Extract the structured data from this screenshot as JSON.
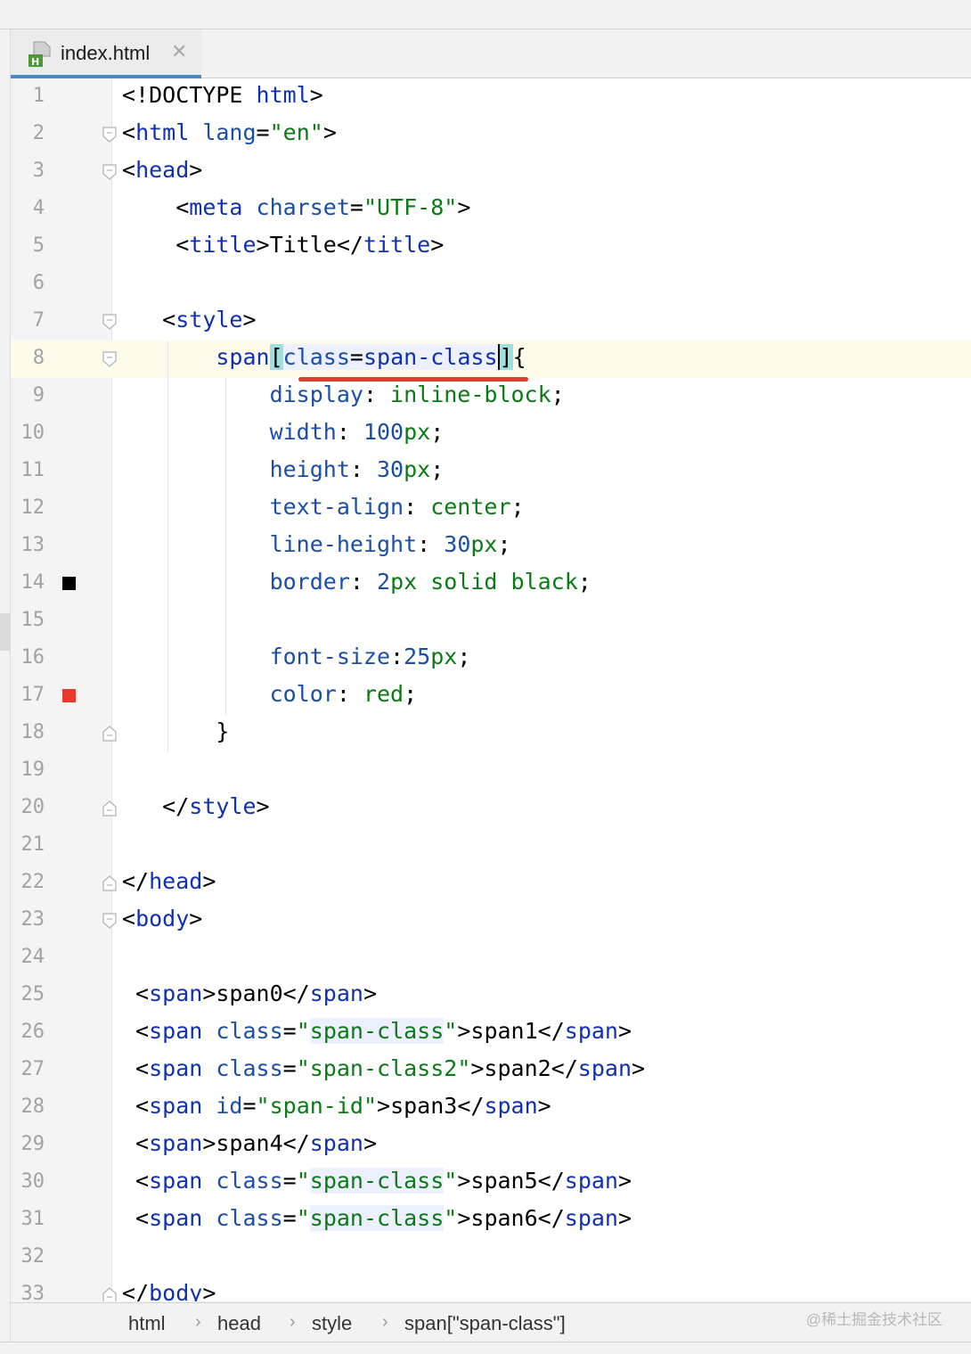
{
  "tab": {
    "filename": "index.html",
    "close": "✕",
    "icon": "html-file-icon"
  },
  "editor": {
    "lines": [
      {
        "n": "1",
        "segs": [
          [
            "p",
            "<!DOCTYPE "
          ],
          [
            "tg",
            "html"
          ],
          [
            "p",
            ">"
          ]
        ]
      },
      {
        "n": "2",
        "fold": "open",
        "segs": [
          [
            "p",
            "<"
          ],
          [
            "tg",
            "html "
          ],
          [
            "at",
            "lang"
          ],
          [
            "p",
            "="
          ],
          [
            "st",
            "\"en\""
          ],
          [
            "p",
            ">"
          ]
        ]
      },
      {
        "n": "3",
        "fold": "open",
        "segs": [
          [
            "p",
            "<"
          ],
          [
            "tg",
            "head"
          ],
          [
            "p",
            ">"
          ]
        ]
      },
      {
        "n": "4",
        "segs": [
          [
            "p",
            "    <"
          ],
          [
            "tg",
            "meta "
          ],
          [
            "at",
            "charset"
          ],
          [
            "p",
            "="
          ],
          [
            "st",
            "\"UTF-8\""
          ],
          [
            "p",
            ">"
          ]
        ]
      },
      {
        "n": "5",
        "segs": [
          [
            "p",
            "    <"
          ],
          [
            "tg",
            "title"
          ],
          [
            "p",
            ">Title</"
          ],
          [
            "tg",
            "title"
          ],
          [
            "p",
            ">"
          ]
        ]
      },
      {
        "n": "6",
        "segs": []
      },
      {
        "n": "7",
        "fold": "open",
        "segs": [
          [
            "p",
            "   <"
          ],
          [
            "tg",
            "style"
          ],
          [
            "p",
            ">"
          ]
        ]
      },
      {
        "n": "8",
        "fold": "open",
        "current": true,
        "segs": [
          [
            "p",
            "       "
          ],
          [
            "tg",
            "span"
          ],
          [
            "br",
            "["
          ],
          [
            "sel-at",
            "class"
          ],
          [
            "sel-p",
            "="
          ],
          [
            "sel-tg",
            "span-clas"
          ],
          [
            "sel-tg-caret",
            "s"
          ],
          [
            "br",
            "]"
          ],
          [
            "p",
            "{"
          ]
        ]
      },
      {
        "n": "9",
        "segs": [
          [
            "p",
            "           "
          ],
          [
            "pr",
            "display"
          ],
          [
            "p",
            ": "
          ],
          [
            "vl",
            "inline-block"
          ],
          [
            "p",
            ";"
          ]
        ]
      },
      {
        "n": "10",
        "segs": [
          [
            "p",
            "           "
          ],
          [
            "pr",
            "width"
          ],
          [
            "p",
            ": "
          ],
          [
            "nm",
            "100"
          ],
          [
            "un",
            "px"
          ],
          [
            "p",
            ";"
          ]
        ]
      },
      {
        "n": "11",
        "segs": [
          [
            "p",
            "           "
          ],
          [
            "pr",
            "height"
          ],
          [
            "p",
            ": "
          ],
          [
            "nm",
            "30"
          ],
          [
            "un",
            "px"
          ],
          [
            "p",
            ";"
          ]
        ]
      },
      {
        "n": "12",
        "segs": [
          [
            "p",
            "           "
          ],
          [
            "pr",
            "text-align"
          ],
          [
            "p",
            ": "
          ],
          [
            "vl",
            "center"
          ],
          [
            "p",
            ";"
          ]
        ]
      },
      {
        "n": "13",
        "segs": [
          [
            "p",
            "           "
          ],
          [
            "pr",
            "line-height"
          ],
          [
            "p",
            ": "
          ],
          [
            "nm",
            "30"
          ],
          [
            "un",
            "px"
          ],
          [
            "p",
            ";"
          ]
        ]
      },
      {
        "n": "14",
        "mark": "#000000",
        "segs": [
          [
            "p",
            "           "
          ],
          [
            "pr",
            "border"
          ],
          [
            "p",
            ": "
          ],
          [
            "nm",
            "2"
          ],
          [
            "un",
            "px "
          ],
          [
            "vl",
            "solid black"
          ],
          [
            "p",
            ";"
          ]
        ]
      },
      {
        "n": "15",
        "segs": []
      },
      {
        "n": "16",
        "segs": [
          [
            "p",
            "           "
          ],
          [
            "pr",
            "font-size"
          ],
          [
            "p",
            ":"
          ],
          [
            "nm",
            "25"
          ],
          [
            "un",
            "px"
          ],
          [
            "p",
            ";"
          ]
        ]
      },
      {
        "n": "17",
        "mark": "#e8392e",
        "segs": [
          [
            "p",
            "           "
          ],
          [
            "pr",
            "color"
          ],
          [
            "p",
            ": "
          ],
          [
            "vl",
            "red"
          ],
          [
            "p",
            ";"
          ]
        ]
      },
      {
        "n": "18",
        "fold": "close",
        "segs": [
          [
            "p",
            "       }"
          ]
        ]
      },
      {
        "n": "19",
        "segs": []
      },
      {
        "n": "20",
        "fold": "close",
        "segs": [
          [
            "p",
            "   </"
          ],
          [
            "tg",
            "style"
          ],
          [
            "p",
            ">"
          ]
        ]
      },
      {
        "n": "21",
        "segs": []
      },
      {
        "n": "22",
        "fold": "close",
        "segs": [
          [
            "p",
            "</"
          ],
          [
            "tg",
            "head"
          ],
          [
            "p",
            ">"
          ]
        ]
      },
      {
        "n": "23",
        "fold": "open",
        "segs": [
          [
            "p",
            "<"
          ],
          [
            "tg",
            "body"
          ],
          [
            "p",
            ">"
          ]
        ]
      },
      {
        "n": "24",
        "segs": []
      },
      {
        "n": "25",
        "segs": [
          [
            "p",
            " <"
          ],
          [
            "tg",
            "span"
          ],
          [
            "p",
            ">span0</"
          ],
          [
            "tg",
            "span"
          ],
          [
            "p",
            ">"
          ]
        ]
      },
      {
        "n": "26",
        "segs": [
          [
            "p",
            " <"
          ],
          [
            "tg",
            "span "
          ],
          [
            "at",
            "class"
          ],
          [
            "p",
            "="
          ],
          [
            "st",
            "\""
          ],
          [
            "st-hl",
            "span-class"
          ],
          [
            "st",
            "\""
          ],
          [
            "p",
            ">span1</"
          ],
          [
            "tg",
            "span"
          ],
          [
            "p",
            ">"
          ]
        ]
      },
      {
        "n": "27",
        "segs": [
          [
            "p",
            " <"
          ],
          [
            "tg",
            "span "
          ],
          [
            "at",
            "class"
          ],
          [
            "p",
            "="
          ],
          [
            "st",
            "\"span-class2\""
          ],
          [
            "p",
            ">span2</"
          ],
          [
            "tg",
            "span"
          ],
          [
            "p",
            ">"
          ]
        ]
      },
      {
        "n": "28",
        "segs": [
          [
            "p",
            " <"
          ],
          [
            "tg",
            "span "
          ],
          [
            "at",
            "id"
          ],
          [
            "p",
            "="
          ],
          [
            "st",
            "\"span-id\""
          ],
          [
            "p",
            ">span3</"
          ],
          [
            "tg",
            "span"
          ],
          [
            "p",
            ">"
          ]
        ]
      },
      {
        "n": "29",
        "segs": [
          [
            "p",
            " <"
          ],
          [
            "tg",
            "span"
          ],
          [
            "p",
            ">span4</"
          ],
          [
            "tg",
            "span"
          ],
          [
            "p",
            ">"
          ]
        ]
      },
      {
        "n": "30",
        "segs": [
          [
            "p",
            " <"
          ],
          [
            "tg",
            "span "
          ],
          [
            "at",
            "class"
          ],
          [
            "p",
            "="
          ],
          [
            "st",
            "\""
          ],
          [
            "st-hl",
            "span-class"
          ],
          [
            "st",
            "\""
          ],
          [
            "p",
            ">span5</"
          ],
          [
            "tg",
            "span"
          ],
          [
            "p",
            ">"
          ]
        ]
      },
      {
        "n": "31",
        "segs": [
          [
            "p",
            " <"
          ],
          [
            "tg",
            "span "
          ],
          [
            "at",
            "class"
          ],
          [
            "p",
            "="
          ],
          [
            "st",
            "\""
          ],
          [
            "st-hl",
            "span-class"
          ],
          [
            "st",
            "\""
          ],
          [
            "p",
            ">span6</"
          ],
          [
            "tg",
            "span"
          ],
          [
            "p",
            ">"
          ]
        ]
      },
      {
        "n": "32",
        "segs": []
      },
      {
        "n": "33",
        "fold": "close",
        "segs": [
          [
            "p",
            "</"
          ],
          [
            "tg",
            "body"
          ],
          [
            "p",
            ">"
          ]
        ]
      }
    ]
  },
  "breadcrumb": {
    "items": [
      "html",
      "head",
      "style",
      "span[\"span-class\"]"
    ],
    "separator": "›"
  },
  "watermark": "@稀土掘金技术社区",
  "colors": {
    "tag": "#0f2fb5",
    "attr": "#1a4ea8",
    "string": "#0a7a14",
    "accent": "#4a88c7",
    "underline": "#e8392e"
  }
}
